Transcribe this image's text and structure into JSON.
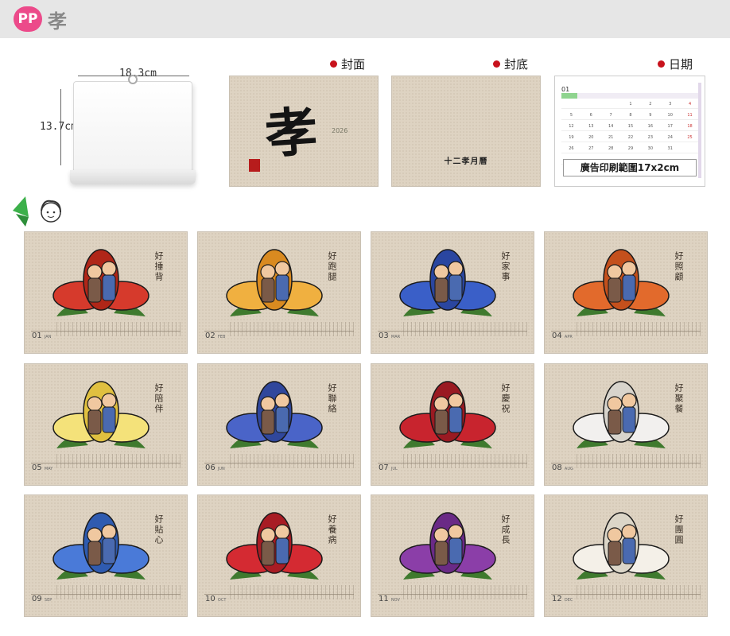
{
  "header": {
    "badge": "PP",
    "title": "孝"
  },
  "product": {
    "width_label": "18.3cm",
    "height_label": "13.7cm"
  },
  "sections": {
    "cover": "封面",
    "back": "封底",
    "date": "日期"
  },
  "cover": {
    "main_char": "孝",
    "year": "2026",
    "seal": "丹青"
  },
  "back": {
    "text": "十二孝月曆"
  },
  "date_page": {
    "month_num": "01",
    "caption": "廣告印刷範圍17x2cm",
    "days": [
      "",
      "",
      "",
      "1",
      "2",
      "3",
      "4",
      "5",
      "6",
      "7",
      "8",
      "9",
      "10",
      "11",
      "12",
      "13",
      "14",
      "15",
      "16",
      "17",
      "18",
      "19",
      "20",
      "21",
      "22",
      "23",
      "24",
      "25",
      "26",
      "27",
      "28",
      "29",
      "30",
      "31",
      "",
      ""
    ]
  },
  "months": [
    {
      "num": "01",
      "abbr": "JAN",
      "title": "好捶背"
    },
    {
      "num": "02",
      "abbr": "FEB",
      "title": "好跑腿"
    },
    {
      "num": "03",
      "abbr": "MAR",
      "title": "好家事"
    },
    {
      "num": "04",
      "abbr": "APR",
      "title": "好照顧"
    },
    {
      "num": "05",
      "abbr": "MAY",
      "title": "好陪伴"
    },
    {
      "num": "06",
      "abbr": "JUN",
      "title": "好聯絡"
    },
    {
      "num": "07",
      "abbr": "JUL",
      "title": "好慶祝"
    },
    {
      "num": "08",
      "abbr": "AUG",
      "title": "好聚餐"
    },
    {
      "num": "09",
      "abbr": "SEP",
      "title": "好貼心"
    },
    {
      "num": "10",
      "abbr": "OCT",
      "title": "好養病"
    },
    {
      "num": "11",
      "abbr": "NOV",
      "title": "好成長"
    },
    {
      "num": "12",
      "abbr": "DEC",
      "title": "好團圓"
    }
  ],
  "colors": {
    "accent": "#ec4a8a",
    "dot": "#c8121c",
    "kraft": "#ded3c2"
  }
}
